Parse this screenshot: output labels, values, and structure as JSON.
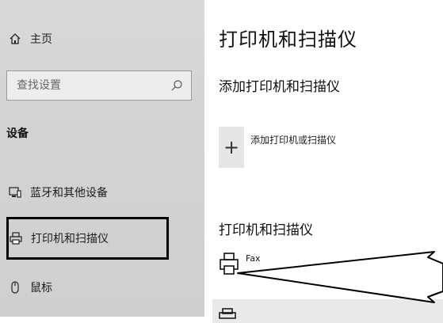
{
  "sidebar": {
    "home_label": "主页",
    "search": {
      "placeholder": "查找设置"
    },
    "section_title": "设备",
    "items": [
      {
        "label": "蓝牙和其他设备",
        "icon": "bluetooth-devices-icon"
      },
      {
        "label": "打印机和扫描仪",
        "icon": "printer-icon",
        "selected": true
      },
      {
        "label": "鼠标",
        "icon": "mouse-icon"
      }
    ]
  },
  "main": {
    "title": "打印机和扫描仪",
    "add_section_title": "添加打印机和扫描仪",
    "add_button_label": "添加打印机或扫描仪",
    "list_title": "打印机和扫描仪",
    "devices": [
      {
        "name": "Fax",
        "icon": "printer-icon"
      }
    ]
  },
  "colors": {
    "sidebar_bg": "#d5d5d5",
    "highlight_border": "#000000",
    "tile_bg": "#e6e6e6"
  }
}
